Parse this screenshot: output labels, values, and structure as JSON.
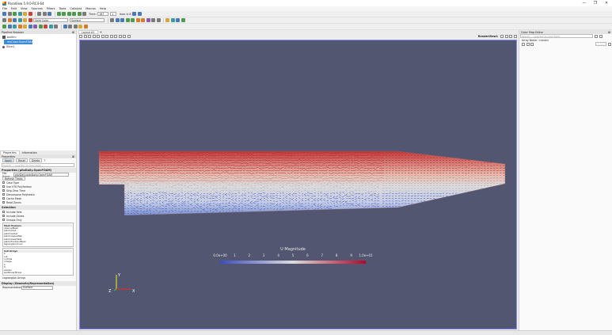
{
  "window": {
    "title": "ParaView 5.9.0-RC4-64",
    "controls": [
      "—",
      "❐",
      "✕"
    ]
  },
  "menu": [
    "File",
    "Edit",
    "View",
    "Sources",
    "Filters",
    "Tools",
    "Catalyst",
    "Macros",
    "Help"
  ],
  "toolbar": {
    "time_label": "Time:",
    "time_value": "167",
    "time_index": "1",
    "max_label": "max is 8",
    "representation": "Solid Color",
    "coloring": "Surface"
  },
  "pipeline_browser": {
    "title": "Pipeline Browser",
    "items": [
      "builtin:",
      "myCase.OpenFOAM",
      "Slice1"
    ]
  },
  "properties": {
    "tabs": [
      "Properties",
      "Information"
    ],
    "header": "Properties",
    "apply_label": "Apply",
    "reset_label": "Reset",
    "delete_label": "Delete",
    "search_placeholder": "Search ... (use Esc to clear text)",
    "reader_title": "Properties (pitzDaily.OpenFOAM)",
    "file_name_label": "File Name",
    "file_name_value": "pitzDaily/pitzDaily.OpenFOAM",
    "refresh_label": "Refresh Times",
    "options": [
      "Case Type",
      "Use VTK Polyhedron",
      "Skip Zero Time",
      "Decompose Polyhedra",
      "Cache Mesh",
      "Read Zones"
    ],
    "selection_title": "Selection",
    "selection_options": [
      "Include Sets",
      "Include Zones",
      "Groups Only"
    ],
    "mesh_regions_header": "Mesh Regions",
    "mesh_regions": [
      "internalMesh",
      "patch/inlet",
      "patch/outlet",
      "patch/upperWall",
      "patch/lowerWall",
      "patch/frontAndBack",
      "lagrangian/cloud"
    ],
    "cell_arrays_header": "Cell Arrays",
    "cell_arrays": [
      "k",
      "nut",
      "nuTilda",
      "omega",
      "p",
      "U",
      "epsilon",
      "wallShearStress"
    ],
    "lagrangian_header": "Lagrangian Arrays",
    "display_title": "Display (GeometryRepresentation)",
    "representation_label": "Representation",
    "representation_value": "Surface"
  },
  "view": {
    "tab_label": "Layout #1",
    "render_label": "RenderView1"
  },
  "color_map_editor": {
    "title": "Color Map Editor",
    "search_placeholder": "Search ... (use Esc to clear text)",
    "array_label": "Array Name: <none>"
  },
  "chart_data": {
    "type": "heatmap",
    "title": "U Magnitude",
    "legend_ticks": [
      "0.0e+00",
      "1",
      "2",
      "3",
      "4",
      "5",
      "6",
      "7",
      "8",
      "9",
      "1.0e+01"
    ],
    "range": [
      0,
      10
    ],
    "axes_labels": [
      "Y",
      "Z",
      "X"
    ],
    "colors": {
      "low": "#3b4cc0",
      "mid": "#dddddd",
      "high": "#b40426"
    }
  }
}
